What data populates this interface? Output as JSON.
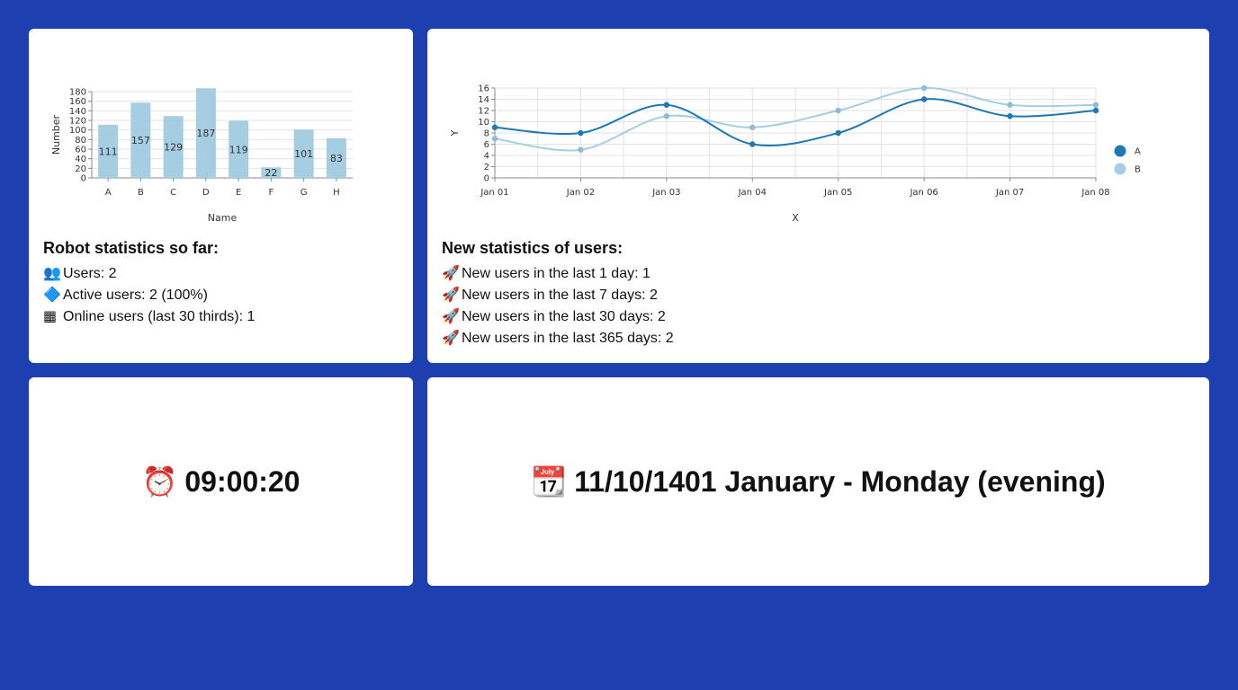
{
  "bar_card": {
    "chart_data": {
      "type": "bar",
      "categories": [
        "A",
        "B",
        "C",
        "D",
        "E",
        "F",
        "G",
        "H"
      ],
      "values": [
        111,
        157,
        129,
        187,
        119,
        22,
        101,
        83
      ],
      "xlabel": "Name",
      "ylabel": "Number",
      "ylim": [
        0,
        180
      ],
      "yticks": [
        0,
        20,
        40,
        60,
        80,
        100,
        120,
        140,
        160,
        180
      ],
      "grid": true,
      "color": "#a6cee3"
    },
    "stats": {
      "title": "Robot statistics so far:",
      "lines": [
        {
          "icon": "👥",
          "text": "Users: 2"
        },
        {
          "icon": "🔷",
          "text": "Active users: 2 (100%)"
        },
        {
          "icon": "▦",
          "text": "Online users (last 30 thirds): 1"
        }
      ]
    }
  },
  "line_card": {
    "chart_data": {
      "type": "line",
      "x": [
        "Jan 01",
        "Jan 02",
        "Jan 03",
        "Jan 04",
        "Jan 05",
        "Jan 06",
        "Jan 07",
        "Jan 08"
      ],
      "series": [
        {
          "name": "A",
          "values": [
            9,
            8,
            13,
            6,
            8,
            14,
            11,
            12
          ],
          "color": "#1f78b4"
        },
        {
          "name": "B",
          "values": [
            7,
            5,
            11,
            9,
            12,
            16,
            13,
            13
          ],
          "color": "#a6cee3"
        }
      ],
      "xlabel": "X",
      "ylabel": "Y",
      "ylim": [
        0,
        16
      ],
      "yticks": [
        0,
        2,
        4,
        6,
        8,
        10,
        12,
        14,
        16
      ],
      "grid": true,
      "legend": "right"
    },
    "stats": {
      "title": "New statistics of users:",
      "lines": [
        {
          "icon": "🚀",
          "text": "New users in the last 1 day: 1"
        },
        {
          "icon": "🚀",
          "text": "New users in the last 7 days: 2"
        },
        {
          "icon": "🚀",
          "text": "New users in the last 30 days: 2"
        },
        {
          "icon": "🚀",
          "text": "New users in the last 365 days: 2"
        }
      ]
    }
  },
  "clock": {
    "icon": "⏰",
    "time": "09:00:20"
  },
  "date": {
    "icon": "📆",
    "text": "11/10/1401 January - Monday (evening)"
  }
}
